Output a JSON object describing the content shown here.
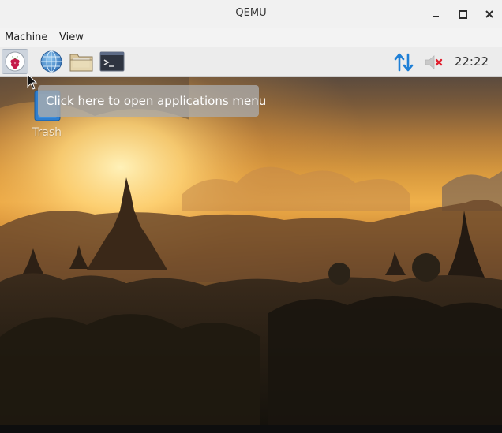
{
  "window": {
    "title": "QEMU"
  },
  "menubar": {
    "items": [
      "Machine",
      "View"
    ]
  },
  "panel": {
    "launchers": [
      {
        "name": "Applications menu",
        "icon": "raspberry-icon"
      },
      {
        "name": "Web browser",
        "icon": "globe-icon"
      },
      {
        "name": "File manager",
        "icon": "folder-icon"
      },
      {
        "name": "Terminal",
        "icon": "terminal-icon"
      }
    ],
    "tray": {
      "network_icon": "network-arrows-icon",
      "volume_icon": "volume-muted-icon",
      "clock": "22:22"
    }
  },
  "desktop": {
    "icons": [
      {
        "label": "Trash",
        "icon": "trash-icon"
      }
    ],
    "tooltip": "Click here to open applications menu"
  },
  "colors": {
    "panel_bg": "#ececec",
    "tray_accent": "#1e7fd6",
    "muted_red": "#e0202e",
    "tooltip_bg": "#aaaaaa"
  }
}
